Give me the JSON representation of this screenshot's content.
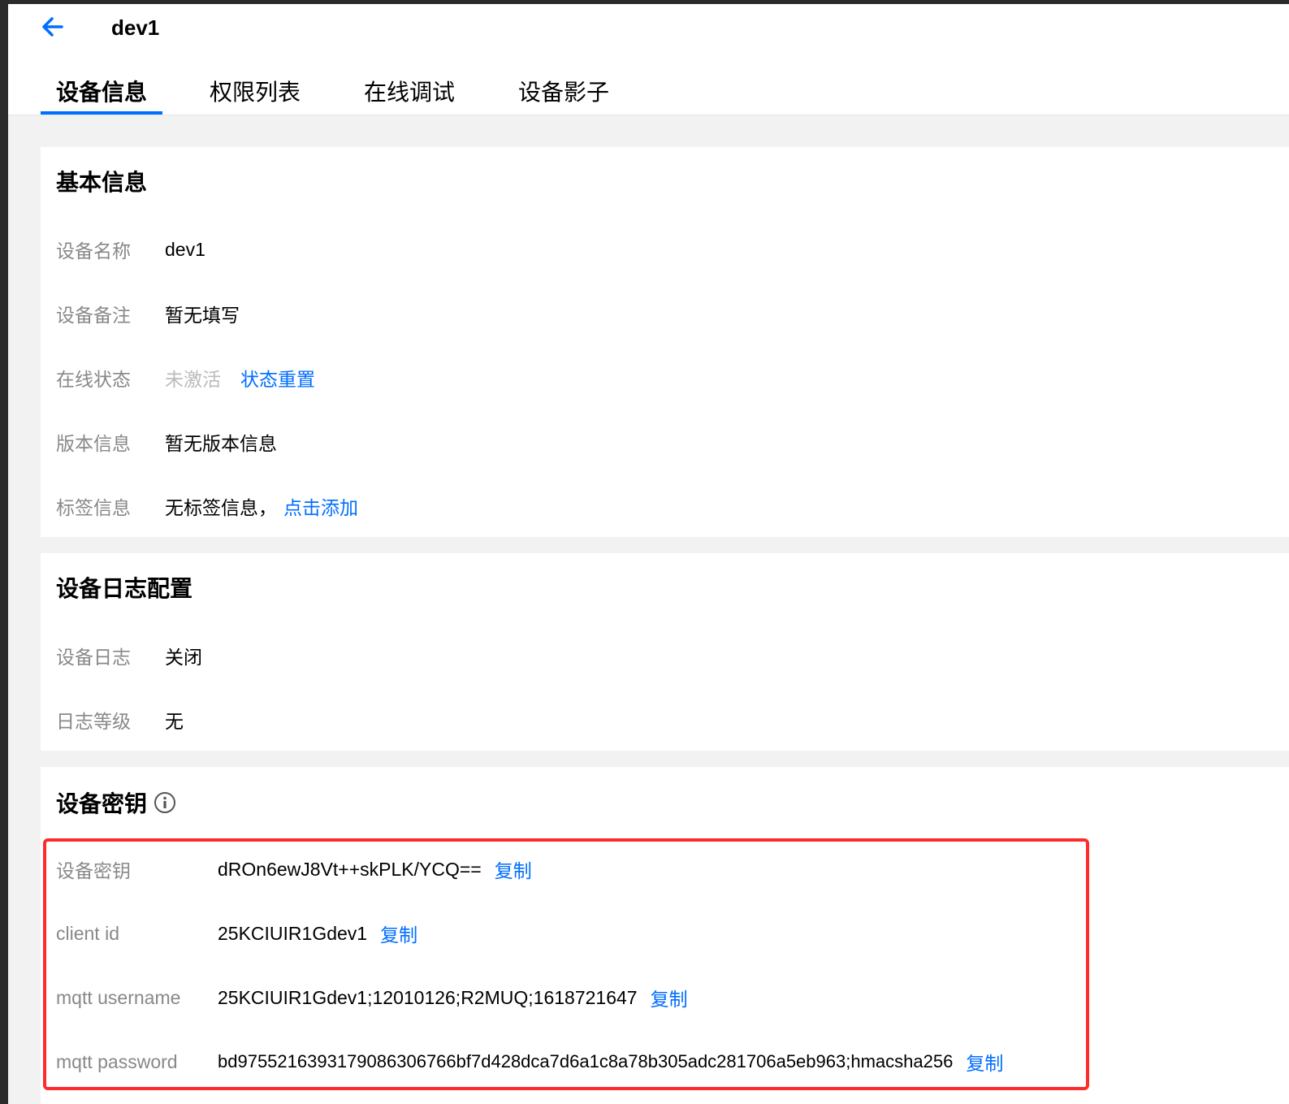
{
  "header": {
    "title": "dev1",
    "tabs": [
      {
        "label": "设备信息",
        "active": true
      },
      {
        "label": "权限列表",
        "active": false
      },
      {
        "label": "在线调试",
        "active": false
      },
      {
        "label": "设备影子",
        "active": false
      }
    ]
  },
  "basic_info": {
    "title": "基本信息",
    "device_name_label": "设备名称",
    "device_name_value": "dev1",
    "device_note_label": "设备备注",
    "device_note_value": "暂无填写",
    "online_status_label": "在线状态",
    "online_status_value": "未激活",
    "status_reset_link": "状态重置",
    "version_label": "版本信息",
    "version_value": "暂无版本信息",
    "tag_label": "标签信息",
    "tag_value": "无标签信息，",
    "tag_add_link": "点击添加"
  },
  "log_config": {
    "title": "设备日志配置",
    "log_label": "设备日志",
    "log_value": "关闭",
    "level_label": "日志等级",
    "level_value": "无"
  },
  "secret": {
    "title": "设备密钥",
    "copy_label": "复制",
    "rows": [
      {
        "label": "设备密钥",
        "value": "dROn6ewJ8Vt++skPLK/YCQ=="
      },
      {
        "label": "client id",
        "value": "25KCIUIR1Gdev1"
      },
      {
        "label": "mqtt username",
        "value": "25KCIUIR1Gdev1;12010126;R2MUQ;1618721647"
      },
      {
        "label": "mqtt password",
        "value": "bd9755216393179086306766bf7d428dca7d6a1c8a78b305adc281706a5eb963;hmacsha256"
      }
    ]
  },
  "colors": {
    "accent": "#006eff",
    "highlight_border": "#ff2b2b",
    "label": "#888888",
    "background": "#f2f2f2"
  }
}
